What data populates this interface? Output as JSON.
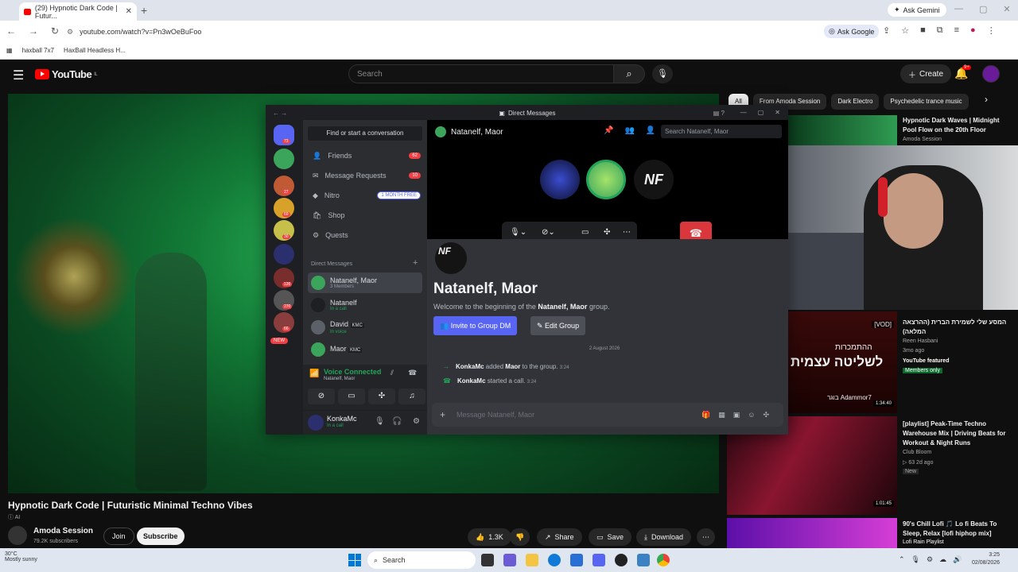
{
  "browser": {
    "tab_title": "(29) Hypnotic Dark Code | Futur...",
    "new_tab": "+",
    "gemini": "Ask Gemini",
    "url": "youtube.com/watch?v=Pn3wOeBuFoo",
    "ask_google": "Ask Google",
    "bookmarks": [
      "haxball 7x7",
      "HaxBall Headless H..."
    ]
  },
  "youtube": {
    "logo": "YouTube",
    "region": "IL",
    "search_placeholder": "Search",
    "create": "Create",
    "bell_badge": "9+",
    "chips": [
      "All",
      "From Amoda Session",
      "Dark Electro",
      "Psychedelic trance music"
    ],
    "video_title": "Hypnotic Dark Code | Futuristic Minimal Techno Vibes",
    "ai_badge": "AI",
    "channel": "Amoda Session",
    "subs": "79.2K subscribers",
    "join": "Join",
    "subscribe": "Subscribe",
    "likes": "1.3K",
    "share": "Share",
    "save": "Save",
    "download": "Download",
    "related": [
      {
        "title": "Hypnotic Dark Waves | Midnight Pool Flow on the 20th Floor",
        "channel": "Amoda Session",
        "meta": "",
        "badge": ""
      },
      {
        "title": "המסע שלי לשמירת הברית (ההרצאה המלאה)",
        "channel": "Reen Hasbani",
        "meta": "3mo ago",
        "badge": "YouTube featured",
        "badge2": "Members only",
        "thumb_text": "לשליטה עצמית",
        "thumb_top": "ההתמכרות",
        "thumb_small": "בוגר Adammor7",
        "vod": "[VOD]",
        "dur": "1:34:40"
      },
      {
        "title": "[playlist] Peak-Time Techno Warehouse Mix | Driving Beats for Workout & Night Runs",
        "channel": "Club Bloom",
        "meta": "63 2d ago",
        "badge": "New",
        "dur": "1:01:45"
      },
      {
        "title": "90's Chill Lofi 🎵 Lo fi Beats To Sleep, Relax [lofi hiphop mix]",
        "channel": "Lofi Rain Playlist",
        "meta": "",
        "badge": ""
      }
    ]
  },
  "discord": {
    "window_title": "Direct Messages",
    "find": "Find or start a conversation",
    "nav": [
      {
        "label": "Friends",
        "badge": "62"
      },
      {
        "label": "Message Requests",
        "badge": "10"
      },
      {
        "label": "Nitro",
        "badge": "1 MONTH FREE"
      },
      {
        "label": "Shop",
        "badge": ""
      },
      {
        "label": "Quests",
        "badge": ""
      }
    ],
    "dm_header": "Direct Messages",
    "add": "+",
    "dms": [
      {
        "name": "Natanelf, Maor",
        "sub": "3 Members"
      },
      {
        "name": "Natanelf",
        "sub": "In a call"
      },
      {
        "name": "David",
        "sub": "In voice",
        "tag": "KMC"
      },
      {
        "name": "Maor",
        "sub": "",
        "tag": "KMC"
      }
    ],
    "guild_badges": [
      "73",
      "27",
      "69",
      "30",
      "126",
      "270",
      "66",
      "NEW"
    ],
    "voice_connected": "Voice Connected",
    "voice_channel": "Natanelf, Maor",
    "user": "KonkaMc",
    "user_status": "In a call",
    "channel": "Natanelf, Maor",
    "search_placeholder": "Search Natanelf, Maor",
    "big_name": "Natanelf, Maor",
    "welcome_pre": "Welcome to the beginning of the ",
    "welcome_name": "Natanelf, Maor",
    "welcome_post": " group.",
    "invite": "Invite to Group DM",
    "edit": "Edit Group",
    "date": "2 August 2026",
    "msg1": {
      "user": "KonkaMc",
      "mid": "added",
      "target": "Maor",
      "rest": "to the group.",
      "time": "3:24"
    },
    "msg2": {
      "user": "KonkaMc",
      "mid": "started a call.",
      "time": "3:24"
    },
    "input_placeholder": "Message Natanelf, Maor",
    "logo_text": "NF"
  },
  "taskbar": {
    "weather": "30°C",
    "weather_sub": "Mostly sunny",
    "search": "Search",
    "time": "3:25",
    "date": "02/08/2026"
  },
  "colors": {
    "accent": "#5865f2",
    "danger": "#da373c",
    "yt_red": "#ff0000",
    "green": "#23a559"
  }
}
